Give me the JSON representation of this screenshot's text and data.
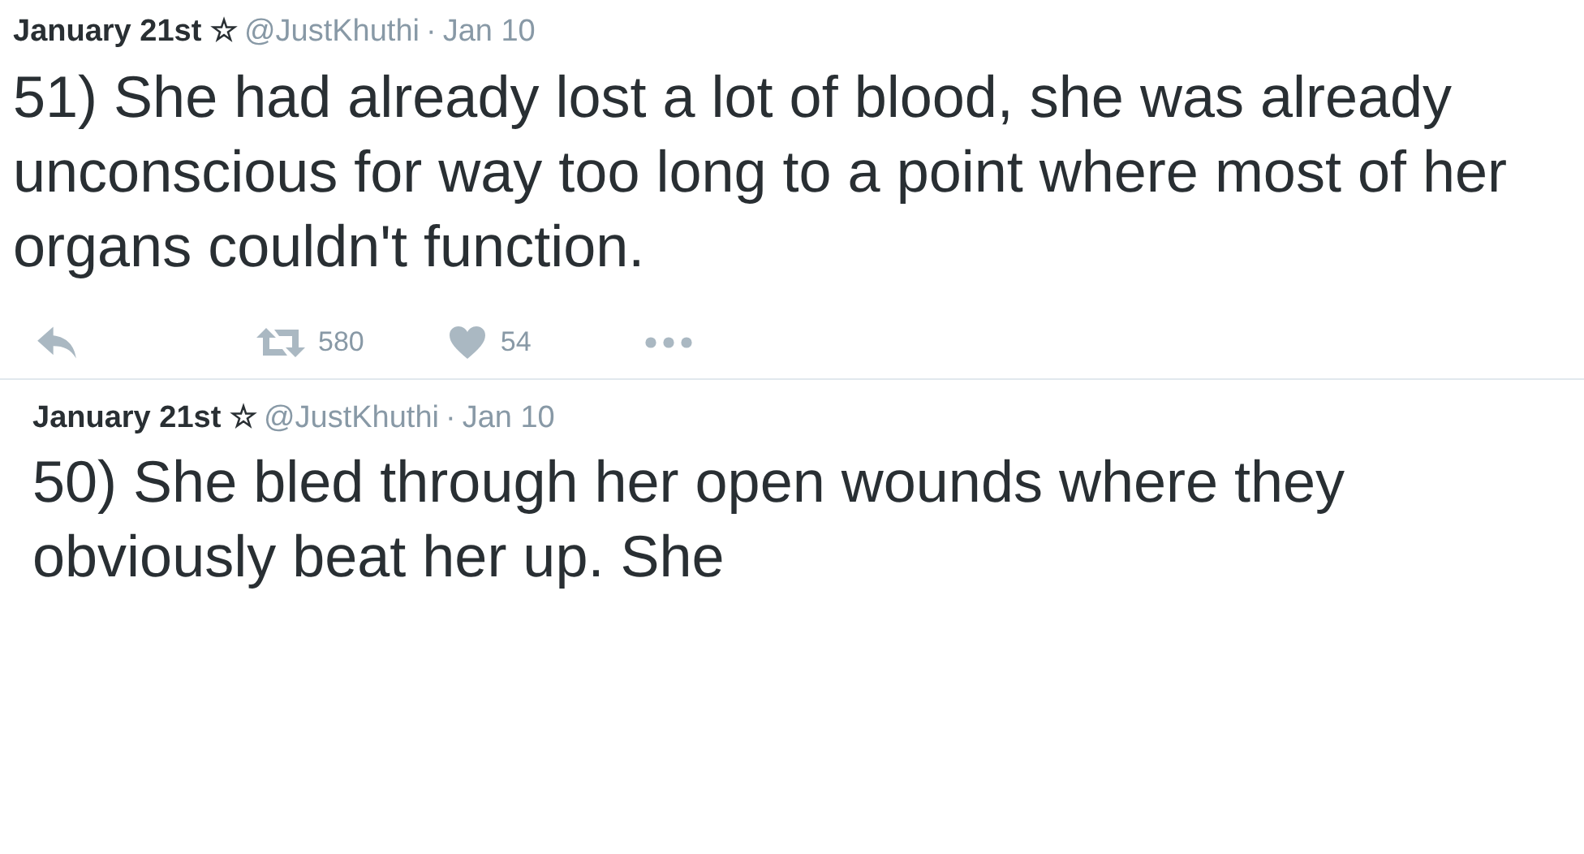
{
  "tweets": [
    {
      "name": "January 21st ☆",
      "handle": "@JustKhuthi",
      "separator": "·",
      "date": "Jan 10",
      "text": "51) She had already lost a lot of blood, she was already unconscious for way too long to a point where most of her organs couldn't function.",
      "actions": {
        "retweets": "580",
        "likes": "54"
      }
    },
    {
      "name": "January 21st ☆",
      "handle": "@JustKhuthi",
      "separator": "·",
      "date": "Jan 10",
      "text": "50) She bled through her open wounds where they obviously beat her up. She"
    }
  ]
}
